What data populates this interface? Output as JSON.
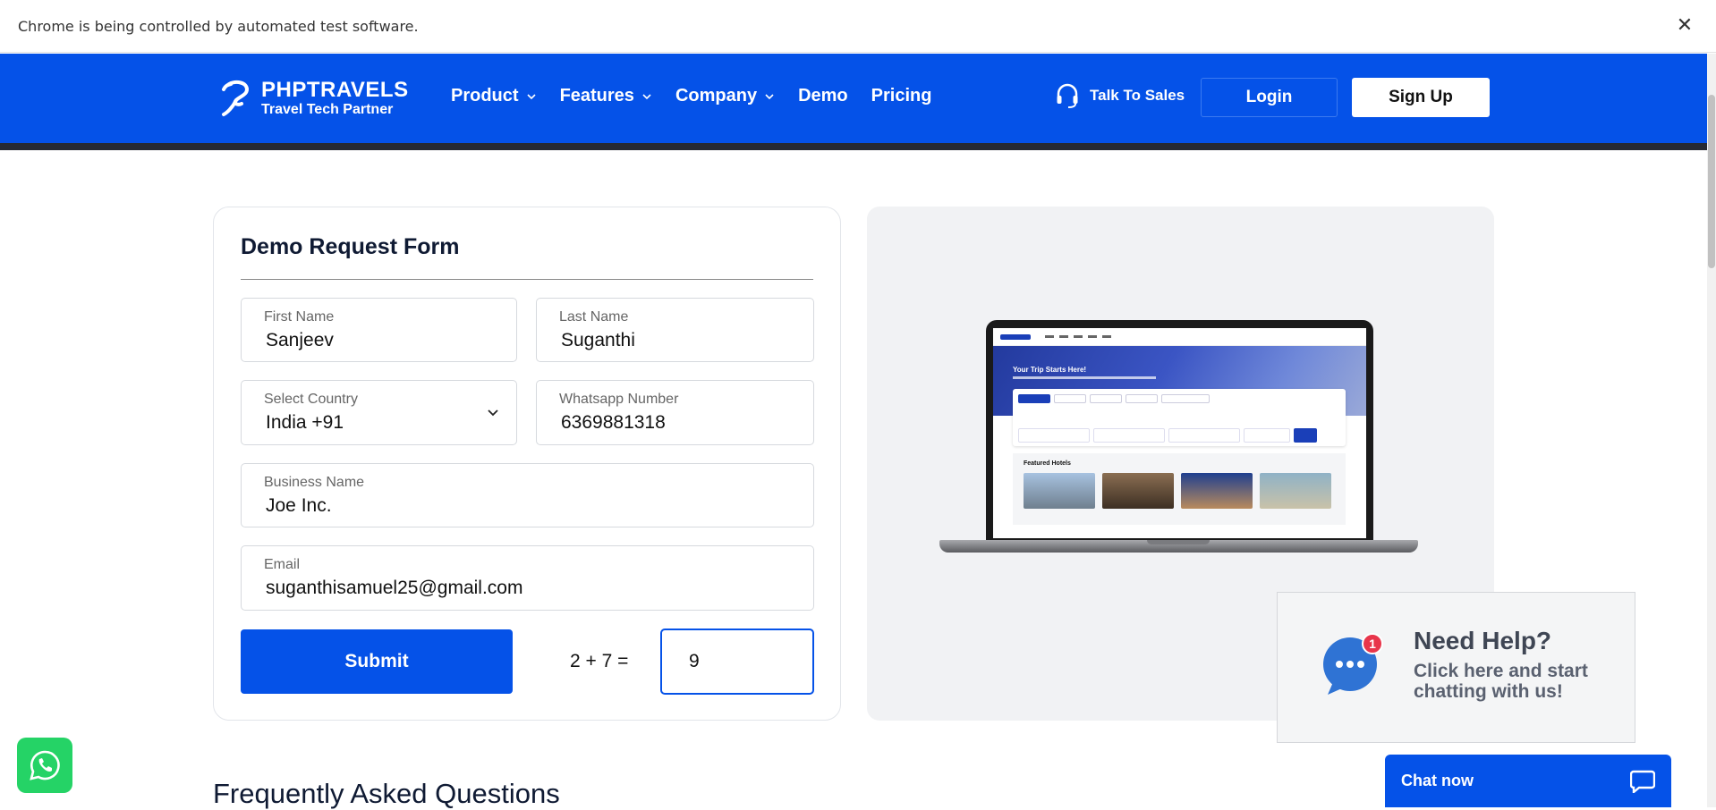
{
  "automation_bar": {
    "message": "Chrome is being controlled by automated test software.",
    "close_glyph": "✕"
  },
  "header": {
    "logo_title": "PHPTRAVELS",
    "logo_subtitle": "Travel Tech Partner",
    "nav": [
      {
        "label": "Product",
        "has_dropdown": true
      },
      {
        "label": "Features",
        "has_dropdown": true
      },
      {
        "label": "Company",
        "has_dropdown": true
      },
      {
        "label": "Demo",
        "has_dropdown": false
      },
      {
        "label": "Pricing",
        "has_dropdown": false
      }
    ],
    "talk_to_sales": "Talk To Sales",
    "login_label": "Login",
    "signup_label": "Sign Up",
    "brand_color": "#0552e8"
  },
  "form": {
    "title": "Demo Request Form",
    "first_name": {
      "label": "First Name",
      "value": "Sanjeev"
    },
    "last_name": {
      "label": "Last Name",
      "value": "Suganthi"
    },
    "country": {
      "label": "Select Country",
      "value": "India +91"
    },
    "whatsapp": {
      "label": "Whatsapp Number",
      "value": "6369881318"
    },
    "business": {
      "label": "Business Name",
      "value": "Joe Inc."
    },
    "email": {
      "label": "Email",
      "value": "suganthisamuel25@gmail.com"
    },
    "submit_label": "Submit",
    "captcha_question": "2 + 7 =",
    "captcha_answer": "9"
  },
  "preview": {
    "hero_title": "Your Trip Starts Here!",
    "featured_title": "Featured Hotels"
  },
  "help_widget": {
    "badge_count": "1",
    "title": "Need Help?",
    "text": "Click here and start chatting with us!"
  },
  "chat": {
    "label": "Chat now"
  },
  "faq": {
    "title": "Frequently Asked Questions"
  },
  "icons": {
    "chevron": "chevron-down-icon",
    "headset": "headset-icon",
    "whatsapp": "whatsapp-icon",
    "chat": "chat-bubble-icon"
  }
}
